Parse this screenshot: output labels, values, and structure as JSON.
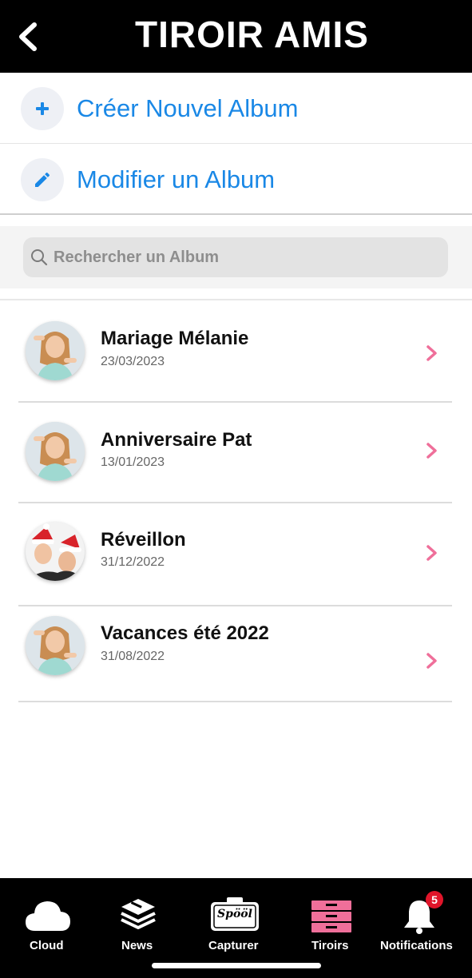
{
  "header": {
    "title": "TIROIR AMIS"
  },
  "actions": {
    "create_label": "Créer Nouvel Album",
    "edit_label": "Modifier un Album"
  },
  "search": {
    "placeholder": "Rechercher un Album"
  },
  "albums": [
    {
      "name": "Mariage Mélanie",
      "date": "23/03/2023",
      "avatar": "woman-photo"
    },
    {
      "name": "Anniversaire Pat",
      "date": "13/01/2023",
      "avatar": "woman-photo"
    },
    {
      "name": "Réveillon",
      "date": "31/12/2022",
      "avatar": "couple-christmas-photo"
    },
    {
      "name": "Vacances été 2022",
      "date": "31/08/2022",
      "avatar": "woman-photo"
    }
  ],
  "tabbar": {
    "cloud": "Cloud",
    "news": "News",
    "capturer": "Capturer",
    "tiroirs": "Tiroirs",
    "notifications": "Notifications",
    "notifications_badge": "5",
    "capture_logo": "Spööl"
  },
  "colors": {
    "accent_blue": "#1a88e6",
    "accent_pink": "#ef6f9a",
    "badge_red": "#e0152a"
  }
}
